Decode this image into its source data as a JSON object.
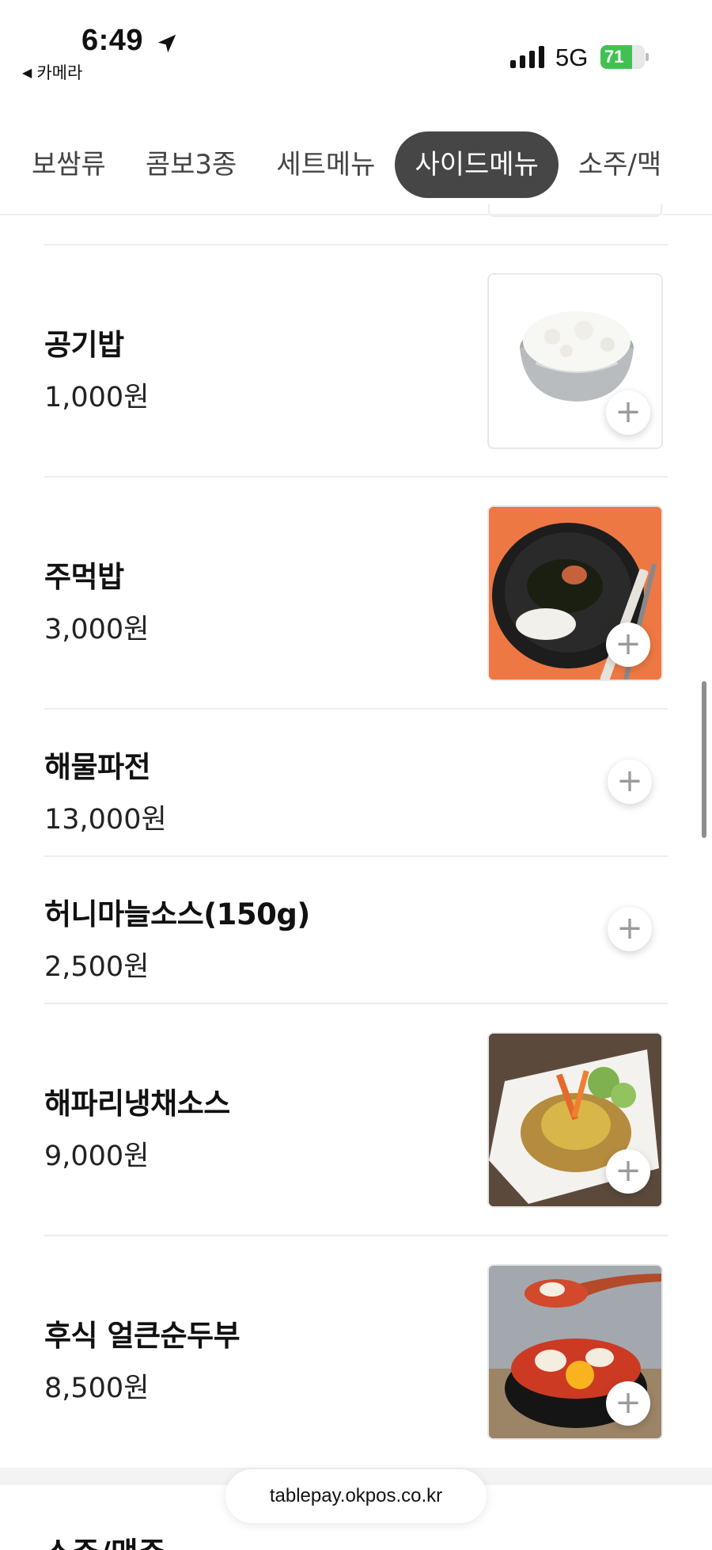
{
  "status_bar": {
    "time": "6:49",
    "back_label": "카메라",
    "network": "5G",
    "battery_level": "71",
    "battery_fraction": 0.71,
    "location_icon": "location-arrow-icon",
    "signal_icon": "cellular-signal-icon"
  },
  "tabs": [
    {
      "label": "보쌈류",
      "active": false
    },
    {
      "label": "콤보3종",
      "active": false
    },
    {
      "label": "세트메뉴",
      "active": false
    },
    {
      "label": "사이드메뉴",
      "active": true
    },
    {
      "label": "소주/맥",
      "active": false
    }
  ],
  "menu_items": [
    {
      "name": "공기밥",
      "price": "1,000원",
      "has_image": true,
      "image": "rice-bowl"
    },
    {
      "name": "주먹밥",
      "price": "3,000원",
      "has_image": true,
      "image": "rice-ball-plate"
    },
    {
      "name": "해물파전",
      "price": "13,000원",
      "has_image": false
    },
    {
      "name": "허니마늘소스(150g)",
      "price": "2,500원",
      "has_image": false
    },
    {
      "name": "해파리냉채소스",
      "price": "9,000원",
      "has_image": true,
      "image": "jellyfish-salad"
    },
    {
      "name": "후식 얼큰순두부",
      "price": "8,500원",
      "has_image": true,
      "image": "spicy-tofu-stew"
    }
  ],
  "add_button_symbol": "+",
  "next_section_title": "소주/맥주",
  "url_bar": {
    "url": "tablepay.okpos.co.kr"
  },
  "colors": {
    "active_tab_bg": "#464646",
    "battery_green": "#42c153",
    "divider": "#eeeeee"
  }
}
